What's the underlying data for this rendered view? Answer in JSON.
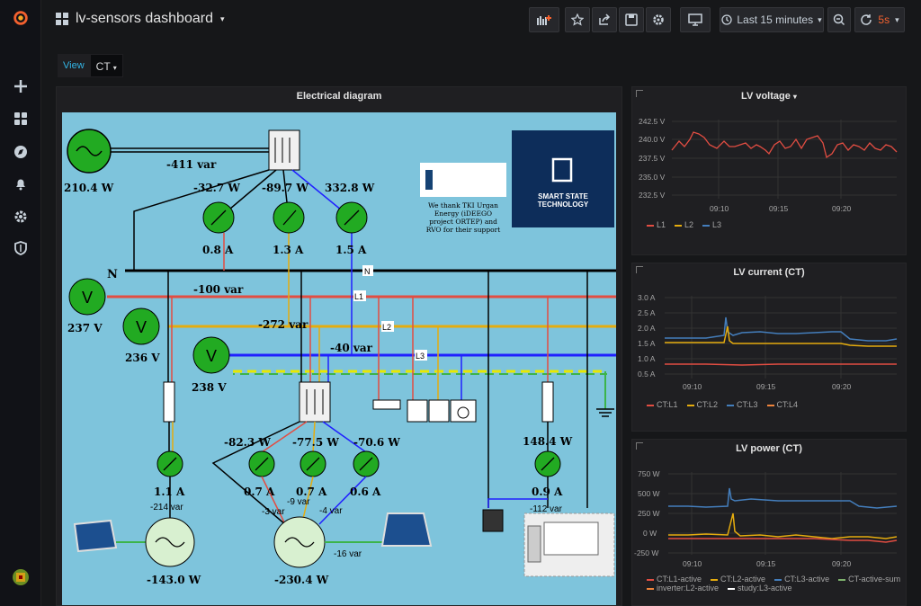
{
  "app": {
    "title": "lv-sensors dashboard"
  },
  "toolbar": {
    "time_range": "Last 15 minutes",
    "refresh": "5s"
  },
  "subbar": {
    "label": "View",
    "value": "CT"
  },
  "diagram": {
    "title": "Electrical diagram",
    "thanks": [
      "We thank TKI Urgan",
      "Energy (iDEEGO",
      "project ORTEP) and",
      "RVO for their support"
    ],
    "sst": [
      "SMART STATE",
      "TECHNOLOGY"
    ],
    "gen_power": "210.4 W",
    "gen_var": "-411 var",
    "main_powers": [
      "-32.7 W",
      "-89.7 W",
      "332.8 W"
    ],
    "main_currents": [
      "0.8 A",
      "1.3 A",
      "1.5 A"
    ],
    "n_label": "N",
    "line_labels": [
      "N",
      "L1",
      "L2",
      "L3"
    ],
    "volts": [
      "237 V",
      "236 V",
      "238 V"
    ],
    "line_vars": [
      "-100 var",
      "-272 var",
      "-40 var"
    ],
    "inv_powers": [
      "-82.3 W",
      "-77.5 W",
      "-70.6 W"
    ],
    "inv_currents": [
      "0.7 A",
      "0.7 A",
      "0.6 A"
    ],
    "inv_vars": [
      "-3 var",
      "-9 var",
      "-4 var"
    ],
    "inv_total": "-230.4 W",
    "inv_side_var": "-16 var",
    "left_current": "1.1 A",
    "left_var": "-214 var",
    "left_power": "-143.0 W",
    "right_power": "148.4 W",
    "right_current": "0.9 A",
    "right_var": "-112 var",
    "v_symbol": "V"
  },
  "voltage_panel": {
    "title": "LV voltage",
    "yticks": [
      "242.5 V",
      "240.0 V",
      "237.5 V",
      "235.0 V",
      "232.5 V"
    ],
    "xticks": [
      "09:10",
      "09:15",
      "09:20"
    ],
    "legend": [
      "L1",
      "L2",
      "L3"
    ]
  },
  "current_panel": {
    "title": "LV current (CT)",
    "yticks": [
      "3.0 A",
      "2.5 A",
      "2.0 A",
      "1.5 A",
      "1.0 A",
      "0.5 A"
    ],
    "xticks": [
      "09:10",
      "09:15",
      "09:20"
    ],
    "legend": [
      "CT:L1",
      "CT:L2",
      "CT:L3",
      "CT:L4"
    ]
  },
  "power_panel": {
    "title": "LV power (CT)",
    "yticks": [
      "750 W",
      "500 W",
      "250 W",
      "0 W",
      "-250 W"
    ],
    "xticks": [
      "09:10",
      "09:15",
      "09:20"
    ],
    "legend": [
      "CT:L1-active",
      "CT:L2-active",
      "CT:L3-active",
      "CT-active-sum",
      "inverter:L2-active",
      "study:L3-active"
    ]
  },
  "colors": {
    "l1": "#e24d42",
    "l2": "#e5ac0e",
    "l3": "#447ebc",
    "l4": "#ba43a9",
    "sum": "#7eb26d",
    "inverter": "#ef843c",
    "study": "#ffffff"
  }
}
